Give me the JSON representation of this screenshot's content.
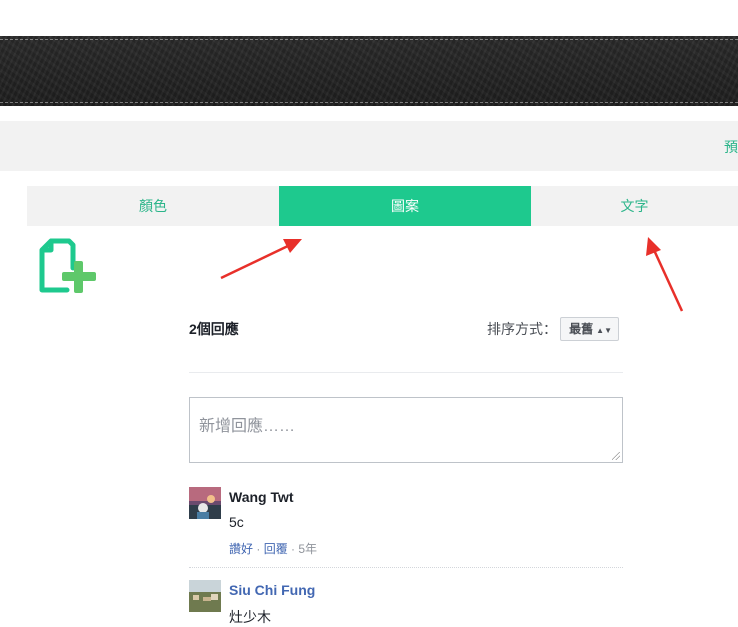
{
  "header": {
    "preview_link": "預覽"
  },
  "tabs": [
    {
      "label": "顏色",
      "active": false
    },
    {
      "label": "圖案",
      "active": true
    },
    {
      "label": "文字",
      "active": false
    }
  ],
  "icons": {
    "add": "add-file-icon",
    "arrow": "red-arrow-annotation"
  },
  "colors": {
    "accent": "#1ec98e",
    "accent_text": "#2bb58a",
    "arrow": "#e8302a",
    "link": "#4267b2"
  },
  "comments": {
    "count_label": "2個回應",
    "sort_label": "排序方式：",
    "sort_value": "最舊",
    "reply_placeholder": "新增回應……",
    "items": [
      {
        "name": "Wang Twt",
        "text": "5c",
        "like": "讚好",
        "reply": "回覆",
        "age": "5年"
      },
      {
        "name": "Siu Chi Fung",
        "text": "灶少木"
      }
    ]
  }
}
